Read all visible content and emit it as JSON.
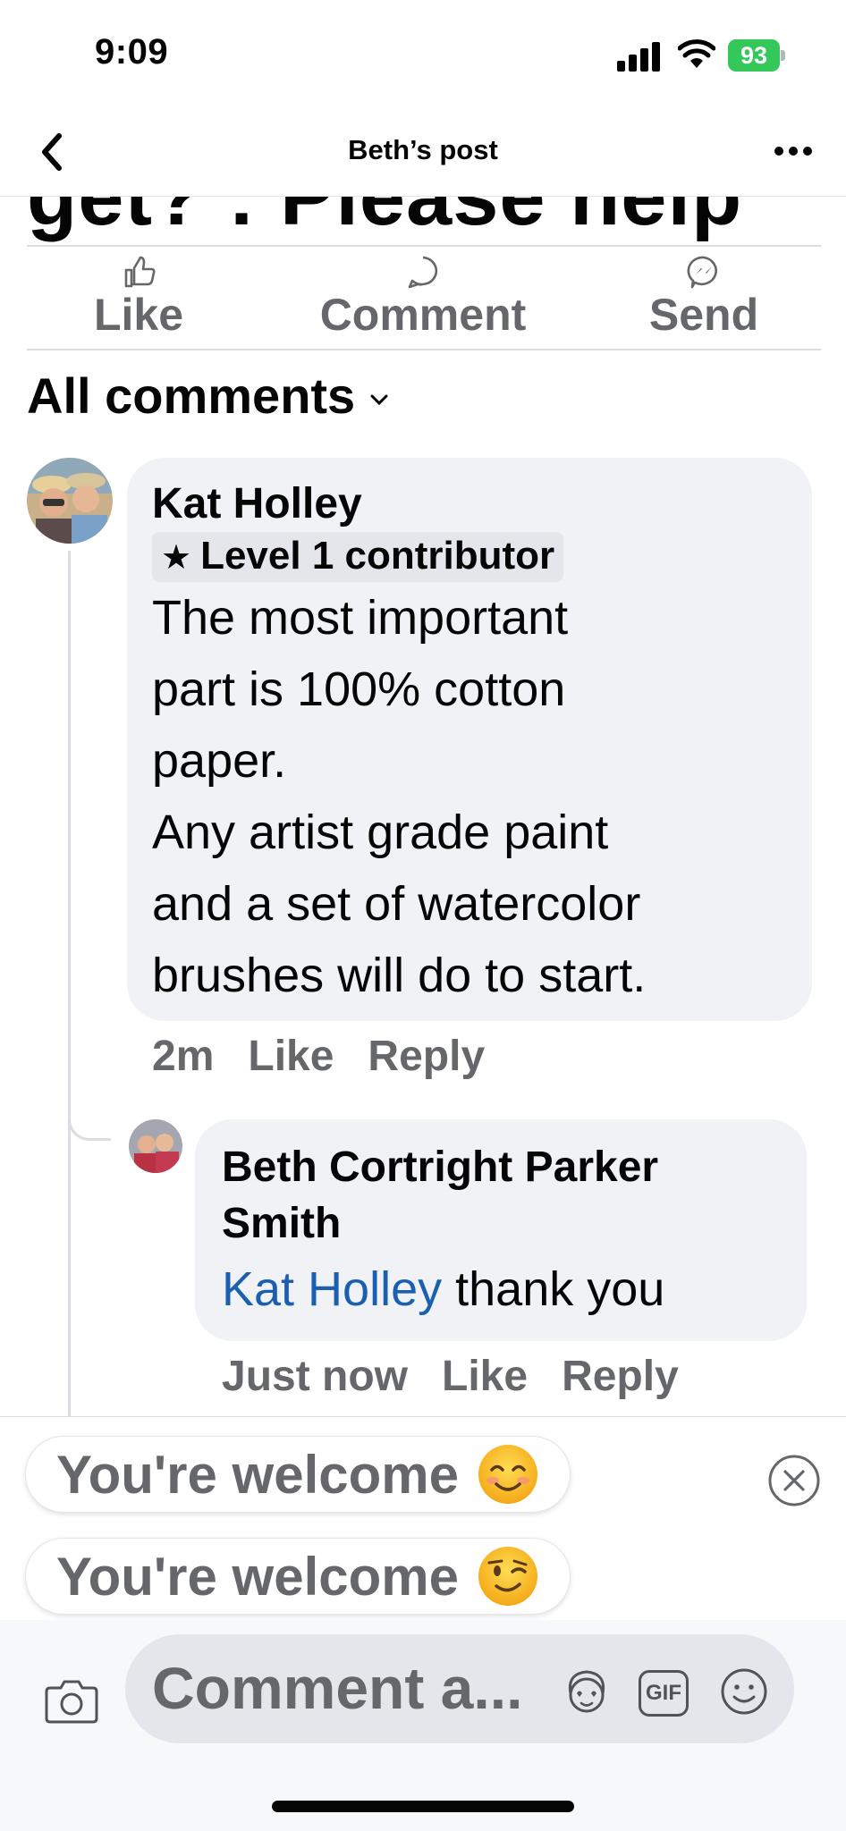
{
  "status_bar": {
    "time": "9:09",
    "battery": "93"
  },
  "nav": {
    "title": "Beth’s post"
  },
  "post": {
    "title_fragment": "get? : Please help"
  },
  "actions": {
    "like": "Like",
    "comment": "Comment",
    "send": "Send"
  },
  "comments_header": {
    "label": "All comments"
  },
  "comments": [
    {
      "author": "Kat Holley",
      "badge": "Level 1 contributor",
      "text_lines": [
        "The most important",
        "part is 100% cotton",
        "paper.",
        "Any artist grade paint",
        "and a set of watercolor",
        "brushes will do to start."
      ],
      "time": "2m",
      "like": "Like",
      "reply": "Reply"
    },
    {
      "author_line1": "Beth Cortright Parker",
      "author_line2": "Smith",
      "mention": "Kat Holley",
      "text": "thank you",
      "time": "Just now",
      "like": "Like",
      "reply": "Reply"
    }
  ],
  "suggestions": [
    {
      "label": "You're welcome",
      "emoji": "smiling-face-icon"
    },
    {
      "label": "You're welcome",
      "emoji": "winking-face-icon"
    }
  ],
  "composer": {
    "placeholder": "Comment a...",
    "gif": "GIF"
  },
  "colors": {
    "accent_blue": "#1b5fb1",
    "battery_green": "#34c759",
    "muted": "#65676b"
  }
}
